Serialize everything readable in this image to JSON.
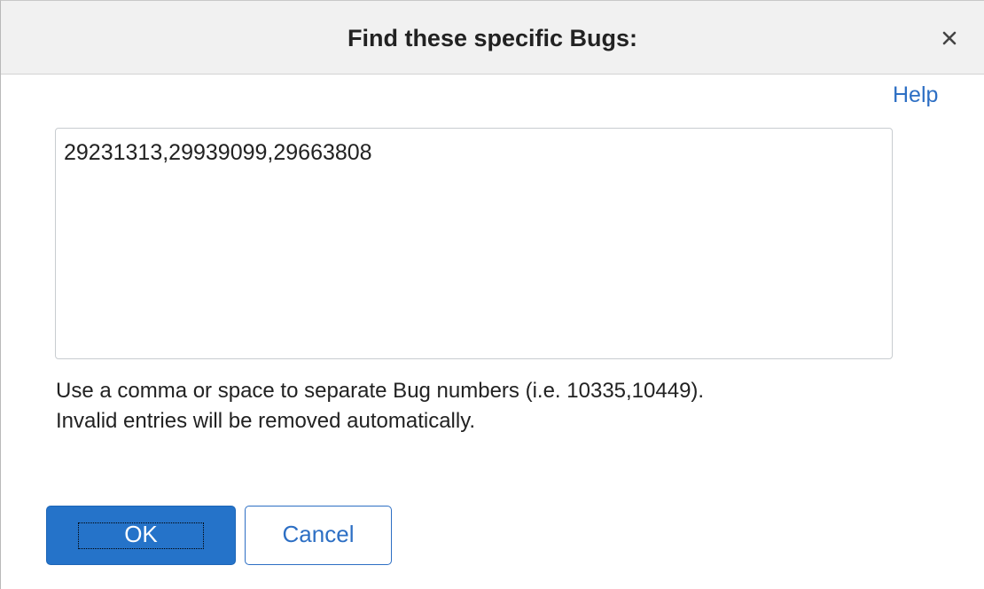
{
  "dialog": {
    "title": "Find these specific Bugs:",
    "close_icon": "close-icon",
    "help_label": "Help",
    "bug_numbers_value": "29231313,29939099,29663808",
    "hint_line1": "Use a comma or space to separate Bug numbers (i.e. 10335,10449).",
    "hint_line2": "Invalid entries will be removed automatically.",
    "ok_label": "OK",
    "cancel_label": "Cancel"
  },
  "colors": {
    "primary": "#2573c9",
    "link": "#2d6fc4",
    "titlebar_bg": "#f1f1f1",
    "text": "#222222"
  }
}
